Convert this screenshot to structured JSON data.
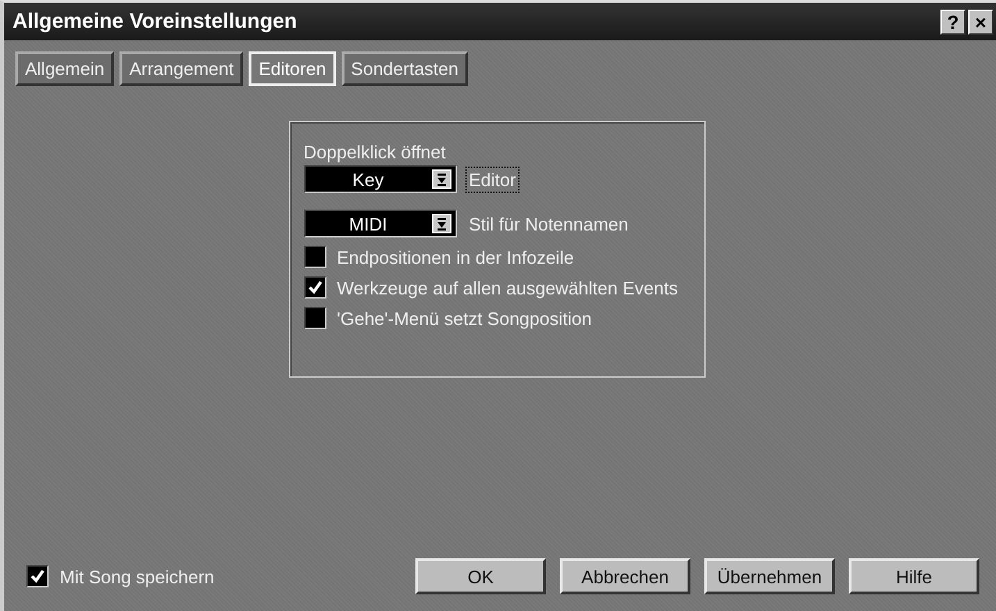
{
  "window": {
    "title": "Allgemeine Voreinstellungen",
    "title_buttons": [
      "?",
      "×"
    ]
  },
  "tabs": [
    {
      "label": "Allgemein",
      "selected": false
    },
    {
      "label": "Arrangement",
      "selected": false
    },
    {
      "label": "Editoren",
      "selected": true
    },
    {
      "label": "Sondertasten",
      "selected": false
    }
  ],
  "group": {
    "heading": "Doppelklick öffnet",
    "dropdowns": [
      {
        "value": "Key",
        "label": "Editor",
        "focused": true
      },
      {
        "value": "MIDI",
        "label": "Stil für Notennamen",
        "focused": false
      }
    ],
    "checkboxes": [
      {
        "label": "Endpositionen in der Infozeile",
        "checked": false
      },
      {
        "label": "Werkzeuge auf allen ausgewählten Events",
        "checked": true
      },
      {
        "label": "'Gehe'-Menü setzt Songposition",
        "checked": false
      }
    ]
  },
  "footer": {
    "checkbox": {
      "label": "Mit Song speichern",
      "checked": true
    },
    "buttons": [
      "OK",
      "Abbrechen",
      "Übernehmen",
      "Hilfe"
    ]
  }
}
